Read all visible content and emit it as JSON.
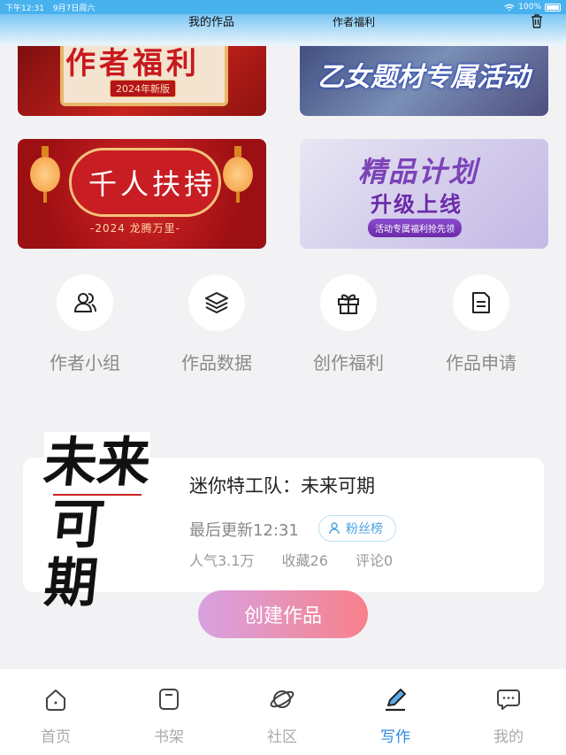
{
  "status_bar": {
    "time": "下午12:31",
    "date": "9月7日周六",
    "battery": "100%"
  },
  "header": {
    "tab_works": "我的作品",
    "tab_welfare": "作者福利"
  },
  "banners": {
    "b1_title": "作者福利",
    "b1_sub": "2024年新版",
    "b2_title": "乙女题材专属活动",
    "b3_title": "千人扶持",
    "b3_sub": "-2024 龙腾万里-",
    "b4_title": "精品计划",
    "b4_sub": "升级上线",
    "b4_pill": "活动专属福利抢先领"
  },
  "quick_actions": [
    {
      "label": "作者小组",
      "icon": "group-icon"
    },
    {
      "label": "作品数据",
      "icon": "layers-icon"
    },
    {
      "label": "创作福利",
      "icon": "gift-icon"
    },
    {
      "label": "作品申请",
      "icon": "document-icon"
    }
  ],
  "book": {
    "cover_line1": "未来",
    "cover_line2": "可期",
    "title": "迷你特工队：未来可期",
    "updated": "最后更新12:31",
    "fans_label": "粉丝榜",
    "popularity": "人气3.1万",
    "favorites": "收藏26",
    "comments": "评论0"
  },
  "create_button": "创建作品",
  "tabbar": [
    {
      "label": "首页",
      "icon": "home-icon"
    },
    {
      "label": "书架",
      "icon": "bookshelf-icon"
    },
    {
      "label": "社区",
      "icon": "planet-icon"
    },
    {
      "label": "写作",
      "icon": "pen-icon",
      "active": true
    },
    {
      "label": "我的",
      "icon": "chat-bubble-icon"
    }
  ],
  "colors": {
    "accent": "#2f8be6",
    "header": "#47b1ef",
    "button_start": "#d8a2e2",
    "button_end": "#f7818b"
  }
}
